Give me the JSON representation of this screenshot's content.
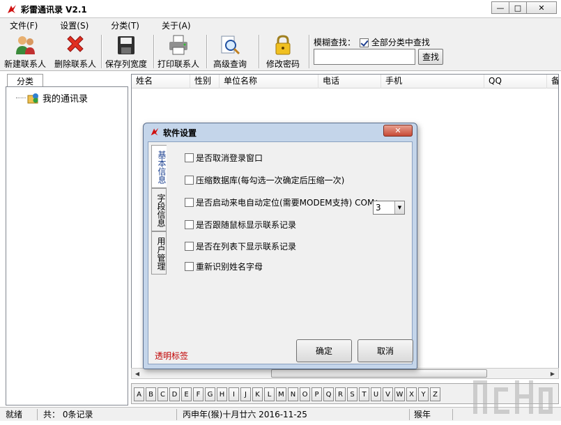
{
  "window": {
    "title": "彩雷通讯录 V2.1",
    "min": "—",
    "max": "□",
    "close": "✕"
  },
  "menu": [
    "文件(F)",
    "设置(S)",
    "分类(T)",
    "关于(A)"
  ],
  "toolbar": {
    "buttons": [
      {
        "label": "新建联系人",
        "icon": "add-user-icon"
      },
      {
        "label": "删除联系人",
        "icon": "delete-icon"
      },
      {
        "label": "保存列宽度",
        "icon": "save-icon"
      },
      {
        "label": "打印联系人",
        "icon": "print-icon"
      },
      {
        "label": "高级查询",
        "icon": "search-icon"
      },
      {
        "label": "修改密码",
        "icon": "lock-icon"
      }
    ],
    "search": {
      "label": "模糊查找：",
      "all_categories_label": "全部分类中查找",
      "all_categories_checked": true,
      "value": "",
      "button_label": "查找"
    }
  },
  "left": {
    "tab_label": "分类",
    "tree_root": "我的通讯录"
  },
  "grid": {
    "columns": [
      "姓名",
      "性别",
      "单位名称",
      "电话",
      "手机",
      "QQ",
      "备"
    ]
  },
  "letters": [
    "A",
    "B",
    "C",
    "D",
    "E",
    "F",
    "G",
    "H",
    "I",
    "J",
    "K",
    "L",
    "M",
    "N",
    "O",
    "P",
    "Q",
    "R",
    "S",
    "T",
    "U",
    "V",
    "W",
    "X",
    "Y",
    "Z"
  ],
  "status": {
    "ready": "就绪",
    "count": "共： 0条记录",
    "date": "丙申年(猴)十月廿六 2016-11-25",
    "zodiac": "猴年"
  },
  "dialog": {
    "title": "软件设置",
    "close": "✕",
    "tabs": [
      "基本信息",
      "字段信息",
      "用户管理"
    ],
    "options": [
      {
        "label": "是否取消登录窗口",
        "checked": false
      },
      {
        "label": "压缩数据库(每勾选一次确定后压缩一次)",
        "checked": false
      },
      {
        "label": "是否启动来电自动定位(需要MODEM支持) COM：",
        "checked": false
      },
      {
        "label": "是否跟随鼠标显示联系记录",
        "checked": false
      },
      {
        "label": "是否在列表下显示联系记录",
        "checked": false
      },
      {
        "label": "重新识别姓名字母",
        "checked": false
      }
    ],
    "com_value": "3",
    "transparent_label": "透明标签",
    "ok_label": "确定",
    "cancel_label": "取消"
  },
  "colors": {
    "dialog_frame": "#c4d5ea",
    "close_red": "#c74a36",
    "transparent_label": "#c00000"
  }
}
